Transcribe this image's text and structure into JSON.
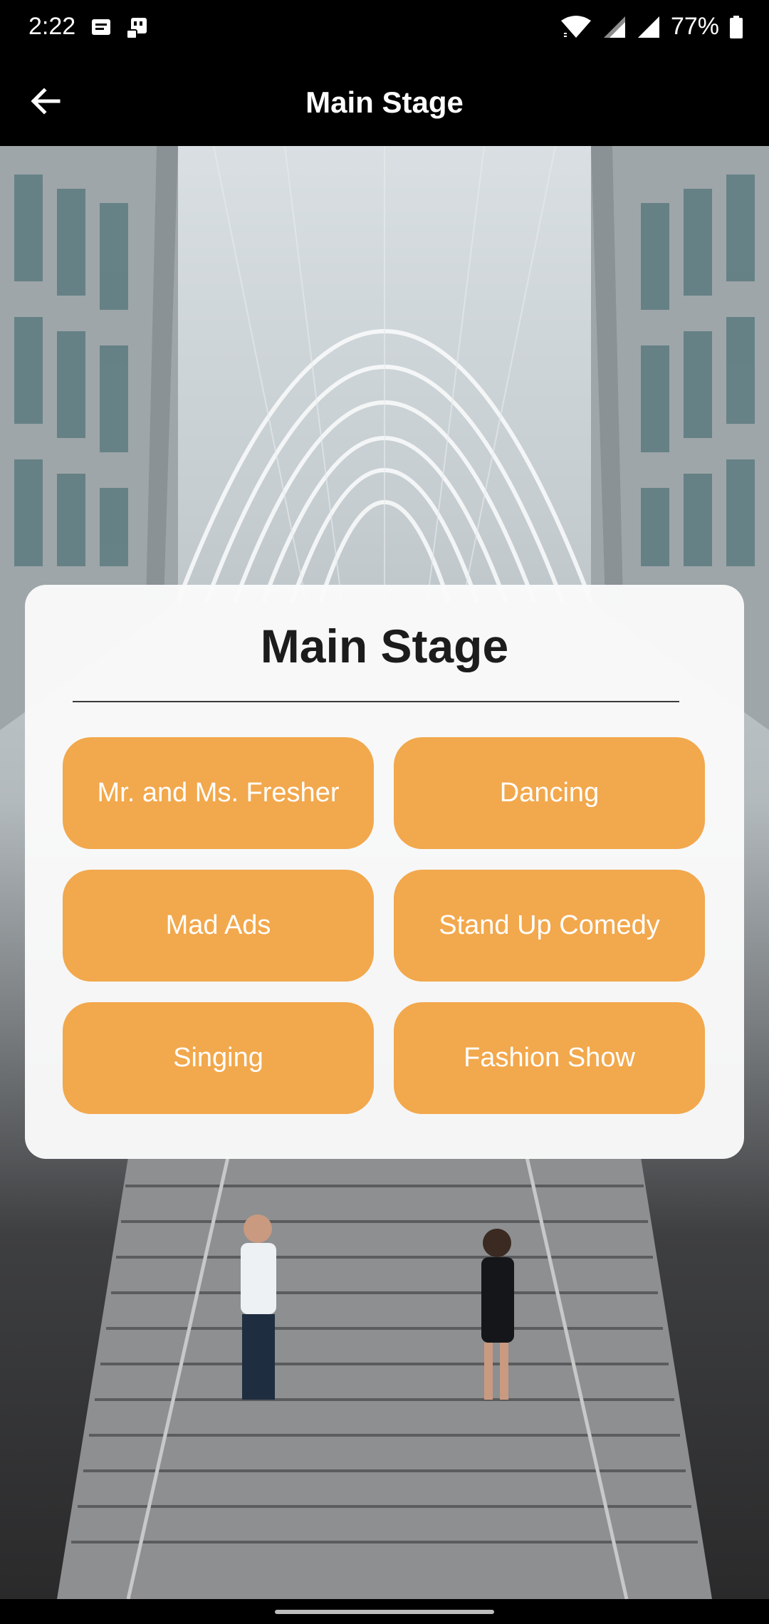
{
  "status_bar": {
    "time": "2:22",
    "battery": "77%",
    "icons": [
      "message-icon",
      "sim-card-icon",
      "wifi-icon",
      "signal-icon",
      "signal-icon",
      "battery-icon"
    ]
  },
  "app_bar": {
    "title": "Main Stage",
    "back_icon": "arrow-back-icon"
  },
  "card": {
    "title": "Main Stage",
    "events": [
      {
        "label": "Mr. and Ms. Fresher"
      },
      {
        "label": "Dancing"
      },
      {
        "label": "Mad Ads"
      },
      {
        "label": "Stand Up Comedy"
      },
      {
        "label": "Singing"
      },
      {
        "label": "Fashion Show"
      }
    ]
  },
  "colors": {
    "accent": "#f2a84c",
    "app_bar": "#000000",
    "card": "#fafafa"
  }
}
